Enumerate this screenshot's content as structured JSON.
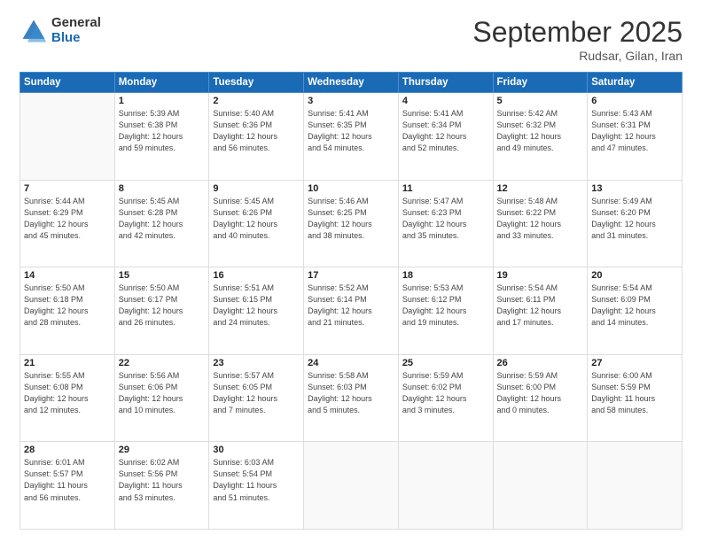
{
  "logo": {
    "general": "General",
    "blue": "Blue"
  },
  "header": {
    "month": "September 2025",
    "location": "Rudsar, Gilan, Iran"
  },
  "weekdays": [
    "Sunday",
    "Monday",
    "Tuesday",
    "Wednesday",
    "Thursday",
    "Friday",
    "Saturday"
  ],
  "weeks": [
    [
      {
        "day": "",
        "info": ""
      },
      {
        "day": "1",
        "info": "Sunrise: 5:39 AM\nSunset: 6:38 PM\nDaylight: 12 hours\nand 59 minutes."
      },
      {
        "day": "2",
        "info": "Sunrise: 5:40 AM\nSunset: 6:36 PM\nDaylight: 12 hours\nand 56 minutes."
      },
      {
        "day": "3",
        "info": "Sunrise: 5:41 AM\nSunset: 6:35 PM\nDaylight: 12 hours\nand 54 minutes."
      },
      {
        "day": "4",
        "info": "Sunrise: 5:41 AM\nSunset: 6:34 PM\nDaylight: 12 hours\nand 52 minutes."
      },
      {
        "day": "5",
        "info": "Sunrise: 5:42 AM\nSunset: 6:32 PM\nDaylight: 12 hours\nand 49 minutes."
      },
      {
        "day": "6",
        "info": "Sunrise: 5:43 AM\nSunset: 6:31 PM\nDaylight: 12 hours\nand 47 minutes."
      }
    ],
    [
      {
        "day": "7",
        "info": "Sunrise: 5:44 AM\nSunset: 6:29 PM\nDaylight: 12 hours\nand 45 minutes."
      },
      {
        "day": "8",
        "info": "Sunrise: 5:45 AM\nSunset: 6:28 PM\nDaylight: 12 hours\nand 42 minutes."
      },
      {
        "day": "9",
        "info": "Sunrise: 5:45 AM\nSunset: 6:26 PM\nDaylight: 12 hours\nand 40 minutes."
      },
      {
        "day": "10",
        "info": "Sunrise: 5:46 AM\nSunset: 6:25 PM\nDaylight: 12 hours\nand 38 minutes."
      },
      {
        "day": "11",
        "info": "Sunrise: 5:47 AM\nSunset: 6:23 PM\nDaylight: 12 hours\nand 35 minutes."
      },
      {
        "day": "12",
        "info": "Sunrise: 5:48 AM\nSunset: 6:22 PM\nDaylight: 12 hours\nand 33 minutes."
      },
      {
        "day": "13",
        "info": "Sunrise: 5:49 AM\nSunset: 6:20 PM\nDaylight: 12 hours\nand 31 minutes."
      }
    ],
    [
      {
        "day": "14",
        "info": "Sunrise: 5:50 AM\nSunset: 6:18 PM\nDaylight: 12 hours\nand 28 minutes."
      },
      {
        "day": "15",
        "info": "Sunrise: 5:50 AM\nSunset: 6:17 PM\nDaylight: 12 hours\nand 26 minutes."
      },
      {
        "day": "16",
        "info": "Sunrise: 5:51 AM\nSunset: 6:15 PM\nDaylight: 12 hours\nand 24 minutes."
      },
      {
        "day": "17",
        "info": "Sunrise: 5:52 AM\nSunset: 6:14 PM\nDaylight: 12 hours\nand 21 minutes."
      },
      {
        "day": "18",
        "info": "Sunrise: 5:53 AM\nSunset: 6:12 PM\nDaylight: 12 hours\nand 19 minutes."
      },
      {
        "day": "19",
        "info": "Sunrise: 5:54 AM\nSunset: 6:11 PM\nDaylight: 12 hours\nand 17 minutes."
      },
      {
        "day": "20",
        "info": "Sunrise: 5:54 AM\nSunset: 6:09 PM\nDaylight: 12 hours\nand 14 minutes."
      }
    ],
    [
      {
        "day": "21",
        "info": "Sunrise: 5:55 AM\nSunset: 6:08 PM\nDaylight: 12 hours\nand 12 minutes."
      },
      {
        "day": "22",
        "info": "Sunrise: 5:56 AM\nSunset: 6:06 PM\nDaylight: 12 hours\nand 10 minutes."
      },
      {
        "day": "23",
        "info": "Sunrise: 5:57 AM\nSunset: 6:05 PM\nDaylight: 12 hours\nand 7 minutes."
      },
      {
        "day": "24",
        "info": "Sunrise: 5:58 AM\nSunset: 6:03 PM\nDaylight: 12 hours\nand 5 minutes."
      },
      {
        "day": "25",
        "info": "Sunrise: 5:59 AM\nSunset: 6:02 PM\nDaylight: 12 hours\nand 3 minutes."
      },
      {
        "day": "26",
        "info": "Sunrise: 5:59 AM\nSunset: 6:00 PM\nDaylight: 12 hours\nand 0 minutes."
      },
      {
        "day": "27",
        "info": "Sunrise: 6:00 AM\nSunset: 5:59 PM\nDaylight: 11 hours\nand 58 minutes."
      }
    ],
    [
      {
        "day": "28",
        "info": "Sunrise: 6:01 AM\nSunset: 5:57 PM\nDaylight: 11 hours\nand 56 minutes."
      },
      {
        "day": "29",
        "info": "Sunrise: 6:02 AM\nSunset: 5:56 PM\nDaylight: 11 hours\nand 53 minutes."
      },
      {
        "day": "30",
        "info": "Sunrise: 6:03 AM\nSunset: 5:54 PM\nDaylight: 11 hours\nand 51 minutes."
      },
      {
        "day": "",
        "info": ""
      },
      {
        "day": "",
        "info": ""
      },
      {
        "day": "",
        "info": ""
      },
      {
        "day": "",
        "info": ""
      }
    ]
  ]
}
